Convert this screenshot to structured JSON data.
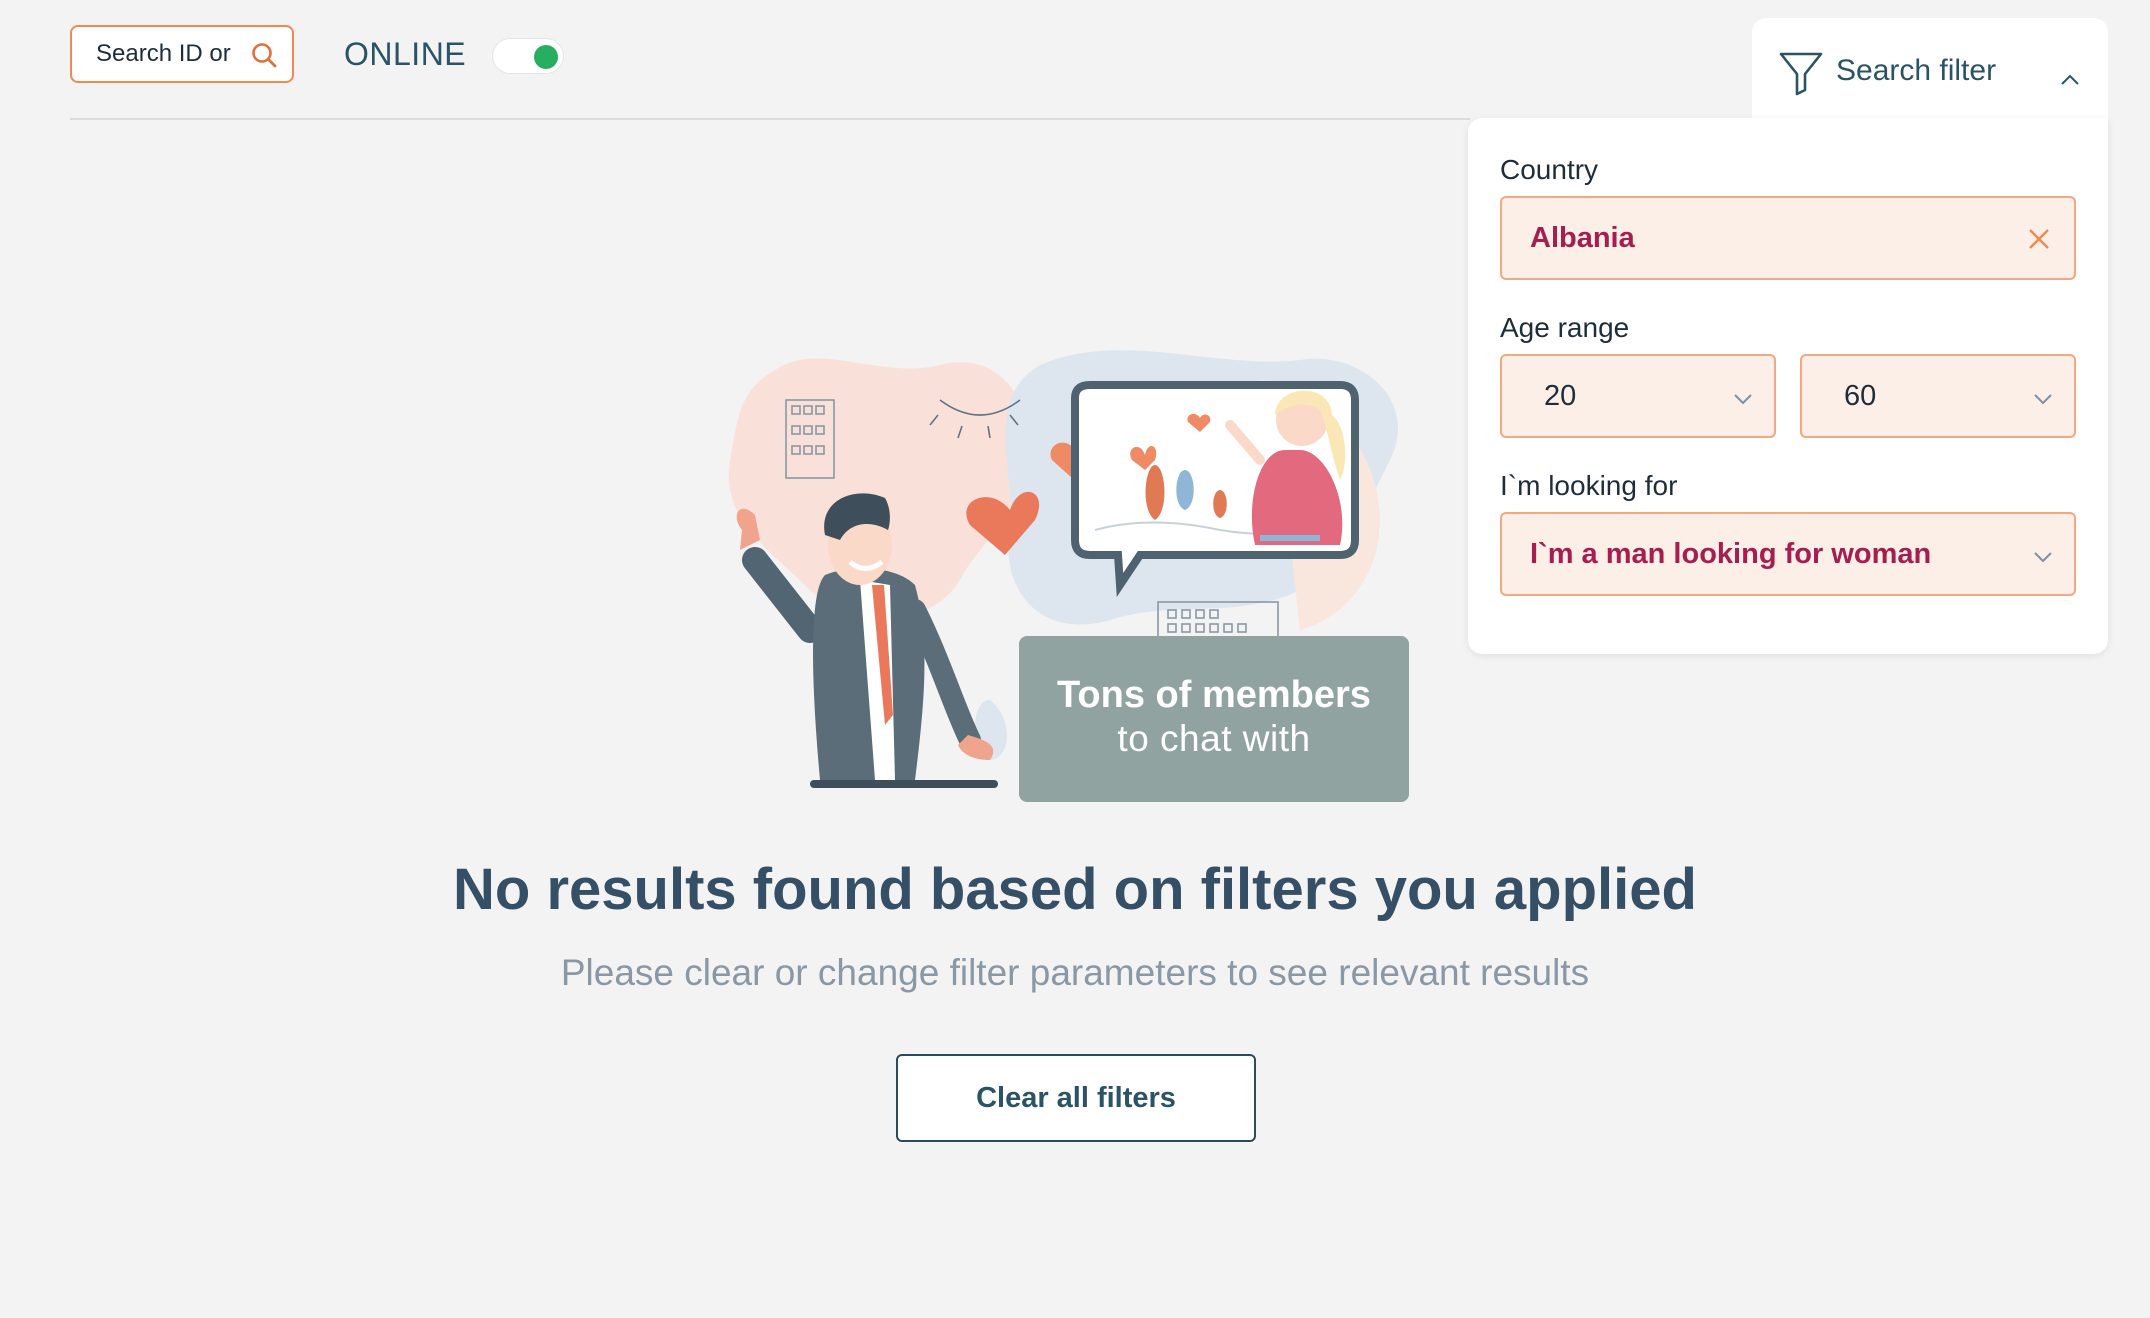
{
  "header": {
    "search_placeholder": "Search ID or",
    "online_label": "ONLINE",
    "online_toggle_on": true
  },
  "filter": {
    "title": "Search filter",
    "country_label": "Country",
    "country_value": "Albania",
    "age_label": "Age range",
    "age_min": "20",
    "age_max": "60",
    "looking_label": "I`m looking for",
    "looking_value": "I`m a man looking for woman"
  },
  "promo": {
    "line1": "Tons of members",
    "line2": "to chat with"
  },
  "empty_state": {
    "headline": "No results found based on filters you applied",
    "subline": "Please clear or change filter parameters to see relevant results",
    "clear_button": "Clear all filters"
  },
  "colors": {
    "accent_orange": "#f08a50",
    "accent_magenta": "#a61d4f",
    "online_green": "#27ae60",
    "heading_navy": "#344f66"
  },
  "icons": [
    "search-icon",
    "funnel-icon",
    "chevron-up-icon",
    "close-icon",
    "chevron-down-icon"
  ]
}
